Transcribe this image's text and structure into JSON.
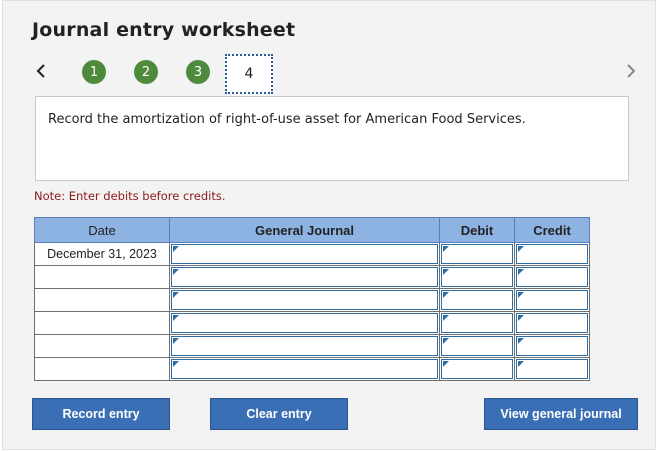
{
  "header": {
    "title": "Journal entry worksheet"
  },
  "steps": [
    {
      "label": "1",
      "state": "complete"
    },
    {
      "label": "2",
      "state": "complete"
    },
    {
      "label": "3",
      "state": "complete"
    },
    {
      "label": "4",
      "state": "current"
    }
  ],
  "instruction": "Record the amortization of right-of-use asset for American Food Services.",
  "note": "Note: Enter debits before credits.",
  "table": {
    "headers": {
      "date": "Date",
      "journal": "General Journal",
      "debit": "Debit",
      "credit": "Credit"
    },
    "rows": [
      {
        "date": "December 31, 2023"
      },
      {
        "date": ""
      },
      {
        "date": ""
      },
      {
        "date": ""
      },
      {
        "date": ""
      },
      {
        "date": ""
      }
    ]
  },
  "buttons": {
    "record": "Record entry",
    "clear": "Clear entry",
    "view": "View general journal"
  },
  "colors": {
    "accent": "#3a6fb5",
    "step_complete": "#4e8a3e",
    "header_bg": "#8db3e2",
    "note": "#8b1a1a"
  },
  "icons": {
    "prev": "chevron-left-icon",
    "next": "chevron-right-icon"
  }
}
